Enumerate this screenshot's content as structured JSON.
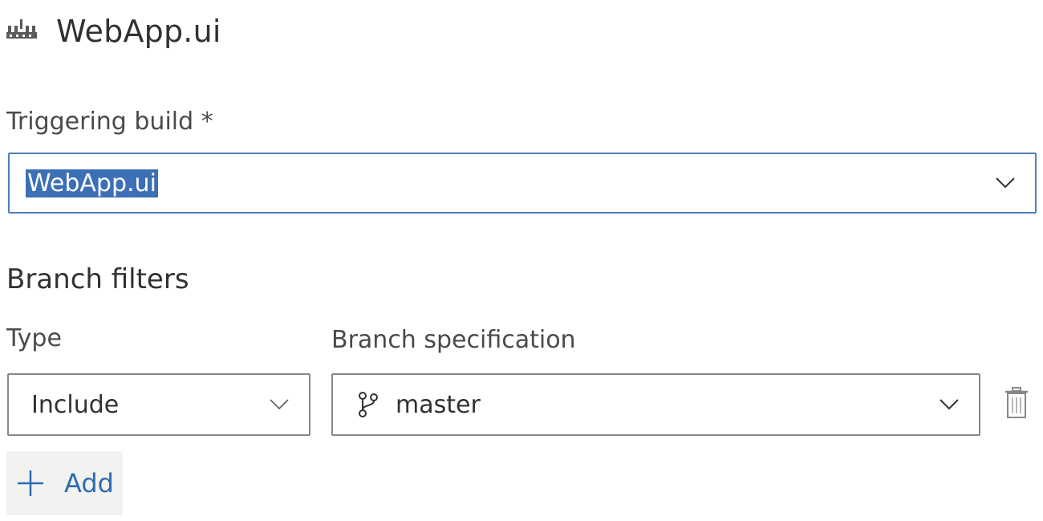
{
  "header": {
    "title": "WebApp.ui",
    "icon": "build-pipeline-icon"
  },
  "triggering_build": {
    "label": "Triggering build *",
    "value": "WebApp.ui"
  },
  "branch_filters": {
    "heading": "Branch filters",
    "type_label": "Type",
    "branch_spec_label": "Branch specification",
    "rows": [
      {
        "type": "Include",
        "branch": "master"
      }
    ],
    "add_label": "Add"
  },
  "colors": {
    "accent": "#2b6cb0",
    "selection": "#3b6fb6",
    "focus_border": "#4f7fbf",
    "border": "#8a8886"
  }
}
